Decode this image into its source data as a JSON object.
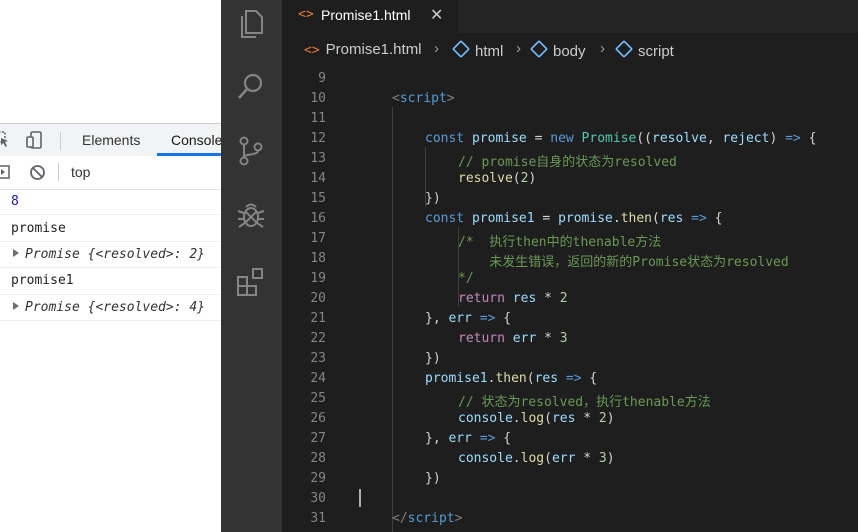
{
  "devtools": {
    "tabs": {
      "elements": "Elements",
      "console": "Console"
    },
    "context": "top",
    "console_lines": [
      {
        "kind": "number",
        "text": "8"
      },
      {
        "kind": "log",
        "text": "promise"
      },
      {
        "kind": "object",
        "text": "Promise {<resolved>: 2}"
      },
      {
        "kind": "log",
        "text": "promise1"
      },
      {
        "kind": "object",
        "text": "Promise {<resolved>: 4}"
      }
    ]
  },
  "editor": {
    "tab": {
      "icon": "<>",
      "title": "Promise1.html",
      "close": "✕"
    },
    "breadcrumb": [
      "Promise1.html",
      "html",
      "body",
      "script"
    ],
    "line_numbers": [
      "9",
      "10",
      "11",
      "12",
      "13",
      "14",
      "15",
      "16",
      "17",
      "18",
      "19",
      "20",
      "21",
      "22",
      "23",
      "24",
      "25",
      "26",
      "27",
      "28",
      "29",
      "30",
      "31"
    ],
    "code": {
      "l10": [
        "<",
        "script",
        ">"
      ],
      "l12": [
        "const",
        " promise",
        " = ",
        "new",
        " Promise",
        "((",
        "resolve",
        ", ",
        "reject",
        ") ",
        "=>",
        " {"
      ],
      "l13": "// promise自身的状态为resolved",
      "l14": [
        "resolve",
        "(",
        "2",
        ")"
      ],
      "l15": "})",
      "l16": [
        "const",
        " promise1",
        " = ",
        "promise",
        ".",
        "then",
        "(",
        "res",
        " ",
        "=>",
        " {"
      ],
      "l17": "/*  执行then中的thenable方法",
      "l18": "    未发生错误，返回的新的Promise状态为resolved",
      "l19": "*/",
      "l20": [
        "return",
        " res",
        " * ",
        "2"
      ],
      "l21": [
        "}, ",
        "err",
        " ",
        "=>",
        " {"
      ],
      "l22": [
        "return",
        " err",
        " * ",
        "3"
      ],
      "l23": "})",
      "l24": [
        "promise1",
        ".",
        "then",
        "(",
        "res",
        " ",
        "=>",
        " {"
      ],
      "l25": "// 状态为resolved，执行thenable方法",
      "l26": [
        "console",
        ".",
        "log",
        "(",
        "res",
        " * ",
        "2",
        ")"
      ],
      "l27": [
        "}, ",
        "err",
        " ",
        "=>",
        " {"
      ],
      "l28": [
        "console",
        ".",
        "log",
        "(",
        "err",
        " * ",
        "3",
        ")"
      ],
      "l29": "})",
      "l31": [
        "</",
        "script",
        ">"
      ]
    }
  },
  "colors": {
    "keyword": "#569cd6",
    "variable": "#9cdcfe",
    "function": "#dcdcaa",
    "class": "#4ec9b0",
    "number": "#b5cea8",
    "comment": "#6a9955",
    "control": "#c586c0",
    "accent": "#1a73e8"
  }
}
